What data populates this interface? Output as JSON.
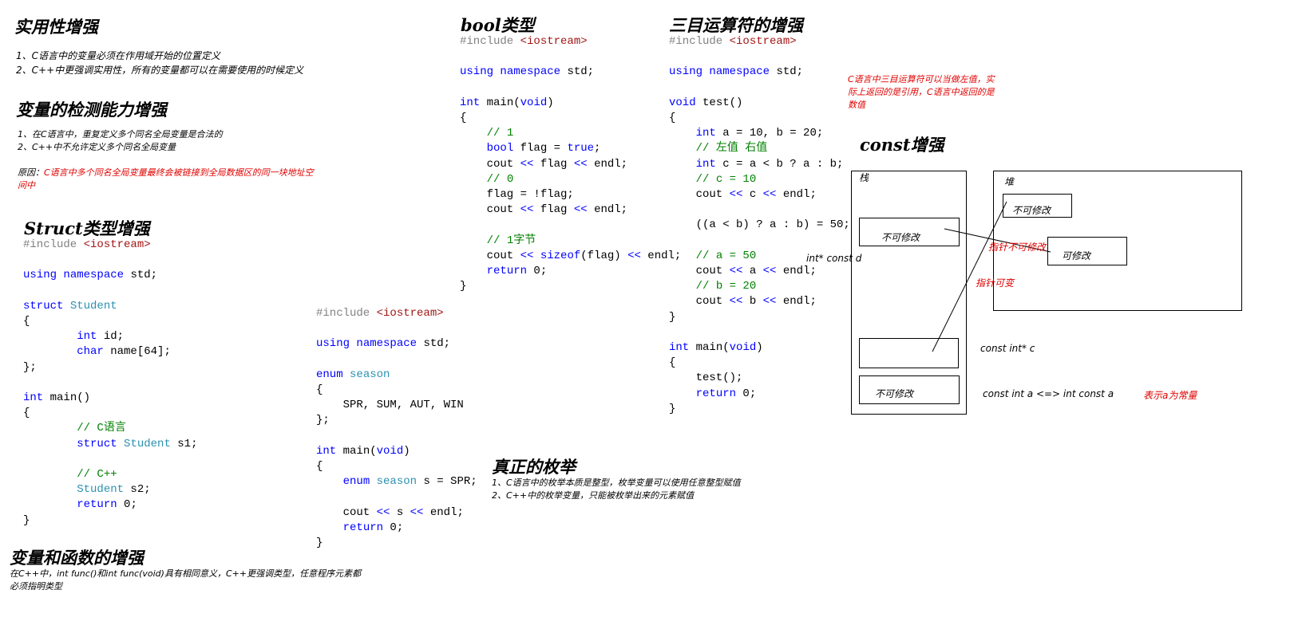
{
  "practicality": {
    "title": "实用性增强",
    "lines": [
      "1、C语言中的变量必须在作用域开始的位置定义",
      "2、C++中更强调实用性，所有的变量都可以在需要使用的时候定义"
    ]
  },
  "detection": {
    "title": "变量的检测能力增强",
    "lines": [
      "1、在C语言中，重复定义多个同名全局变量是合法的",
      "2、C++中不允许定义多个同名全局变量"
    ],
    "reason_prefix": "原因：",
    "reason_line1": "C语言中多个同名全局变量最终会被链接到全局数据区的同一块地址空",
    "reason_line2": "间中"
  },
  "struct_section": {
    "title": "Struct类型增强",
    "code": [
      [
        [
          "pp",
          "#include "
        ],
        [
          "inc",
          "<iostream>"
        ]
      ],
      [],
      [
        [
          "kw",
          "using"
        ],
        [
          "pl",
          " "
        ],
        [
          "kw",
          "namespace"
        ],
        [
          "pl",
          " std;"
        ]
      ],
      [],
      [
        [
          "kw",
          "struct"
        ],
        [
          "pl",
          " "
        ],
        [
          "ty",
          "Student"
        ]
      ],
      [
        [
          "pl",
          "{"
        ]
      ],
      [
        [
          "pl",
          "        "
        ],
        [
          "kw",
          "int"
        ],
        [
          "pl",
          " id;"
        ]
      ],
      [
        [
          "pl",
          "        "
        ],
        [
          "kw",
          "char"
        ],
        [
          "pl",
          " name[64];"
        ]
      ],
      [
        [
          "pl",
          "};"
        ]
      ],
      [],
      [
        [
          "kw",
          "int"
        ],
        [
          "pl",
          " main()"
        ]
      ],
      [
        [
          "pl",
          "{"
        ]
      ],
      [
        [
          "pl",
          "        "
        ],
        [
          "cm",
          "// C语言"
        ]
      ],
      [
        [
          "pl",
          "        "
        ],
        [
          "kw",
          "struct"
        ],
        [
          "pl",
          " "
        ],
        [
          "ty",
          "Student"
        ],
        [
          "pl",
          " s1;"
        ]
      ],
      [],
      [
        [
          "pl",
          "        "
        ],
        [
          "cm",
          "// C++"
        ]
      ],
      [
        [
          "pl",
          "        "
        ],
        [
          "ty",
          "Student"
        ],
        [
          "pl",
          " s2;"
        ]
      ],
      [
        [
          "pl",
          "        "
        ],
        [
          "kw",
          "return"
        ],
        [
          "pl",
          " 0;"
        ]
      ],
      [
        [
          "pl",
          "}"
        ]
      ]
    ]
  },
  "enum_code": [
    [
      [
        "pp",
        "#include "
      ],
      [
        "inc",
        "<iostream>"
      ]
    ],
    [],
    [
      [
        "kw",
        "using"
      ],
      [
        "pl",
        " "
      ],
      [
        "kw",
        "namespace"
      ],
      [
        "pl",
        " std;"
      ]
    ],
    [],
    [
      [
        "kw",
        "enum"
      ],
      [
        "pl",
        " "
      ],
      [
        "ty",
        "season"
      ]
    ],
    [
      [
        "pl",
        "{"
      ]
    ],
    [
      [
        "pl",
        "    SPR, SUM, AUT, WIN"
      ]
    ],
    [
      [
        "pl",
        "};"
      ]
    ],
    [],
    [
      [
        "kw",
        "int"
      ],
      [
        "pl",
        " main("
      ],
      [
        "kw",
        "void"
      ],
      [
        "pl",
        ")"
      ]
    ],
    [
      [
        "pl",
        "{"
      ]
    ],
    [
      [
        "pl",
        "    "
      ],
      [
        "kw",
        "enum"
      ],
      [
        "pl",
        " "
      ],
      [
        "ty",
        "season"
      ],
      [
        "pl",
        " s = SPR;"
      ]
    ],
    [],
    [
      [
        "pl",
        "    cout "
      ],
      [
        "op",
        "<<"
      ],
      [
        "pl",
        " s "
      ],
      [
        "op",
        "<<"
      ],
      [
        "pl",
        " endl;"
      ]
    ],
    [
      [
        "pl",
        "    "
      ],
      [
        "kw",
        "return"
      ],
      [
        "pl",
        " 0;"
      ]
    ],
    [
      [
        "pl",
        "}"
      ]
    ]
  ],
  "var_func": {
    "title": "变量和函数的增强",
    "line1": "在C++中，int func()和int func(void)具有相同意义，C++更强调类型，任意程序元素都",
    "line2": "必须指明类型"
  },
  "bool_section": {
    "title": "bool类型",
    "code": [
      [
        [
          "pp",
          "#include "
        ],
        [
          "inc",
          "<iostream>"
        ]
      ],
      [],
      [
        [
          "kw",
          "using"
        ],
        [
          "pl",
          " "
        ],
        [
          "kw",
          "namespace"
        ],
        [
          "pl",
          " std;"
        ]
      ],
      [],
      [
        [
          "kw",
          "int"
        ],
        [
          "pl",
          " main("
        ],
        [
          "kw",
          "void"
        ],
        [
          "pl",
          ")"
        ]
      ],
      [
        [
          "pl",
          "{"
        ]
      ],
      [
        [
          "pl",
          "    "
        ],
        [
          "cm",
          "// 1"
        ]
      ],
      [
        [
          "pl",
          "    "
        ],
        [
          "kw",
          "bool"
        ],
        [
          "pl",
          " flag = "
        ],
        [
          "kw",
          "true"
        ],
        [
          "pl",
          ";"
        ]
      ],
      [
        [
          "pl",
          "    cout "
        ],
        [
          "op",
          "<<"
        ],
        [
          "pl",
          " flag "
        ],
        [
          "op",
          "<<"
        ],
        [
          "pl",
          " endl;"
        ]
      ],
      [
        [
          "pl",
          "    "
        ],
        [
          "cm",
          "// 0"
        ]
      ],
      [
        [
          "pl",
          "    flag = !flag;"
        ]
      ],
      [
        [
          "pl",
          "    cout "
        ],
        [
          "op",
          "<<"
        ],
        [
          "pl",
          " flag "
        ],
        [
          "op",
          "<<"
        ],
        [
          "pl",
          " endl;"
        ]
      ],
      [],
      [
        [
          "pl",
          "    "
        ],
        [
          "cm",
          "// 1字节"
        ]
      ],
      [
        [
          "pl",
          "    cout "
        ],
        [
          "op",
          "<<"
        ],
        [
          "pl",
          " "
        ],
        [
          "kw",
          "sizeof"
        ],
        [
          "pl",
          "(flag) "
        ],
        [
          "op",
          "<<"
        ],
        [
          "pl",
          " endl;"
        ]
      ],
      [
        [
          "pl",
          "    "
        ],
        [
          "kw",
          "return"
        ],
        [
          "pl",
          " 0;"
        ]
      ],
      [
        [
          "pl",
          "}"
        ]
      ]
    ]
  },
  "enum_real": {
    "title": "真正的枚举",
    "lines": [
      "1、C语言中的枚举本质是整型，枚举变量可以使用任意整型赋值",
      "2、C++中的枚举变量，只能被枚举出来的元素赋值"
    ]
  },
  "ternary_section": {
    "title": "三目运算符的增强",
    "code": [
      [
        [
          "pp",
          "#include "
        ],
        [
          "inc",
          "<iostream>"
        ]
      ],
      [],
      [
        [
          "kw",
          "using"
        ],
        [
          "pl",
          " "
        ],
        [
          "kw",
          "namespace"
        ],
        [
          "pl",
          " std;"
        ]
      ],
      [],
      [
        [
          "kw",
          "void"
        ],
        [
          "pl",
          " test()"
        ]
      ],
      [
        [
          "pl",
          "{"
        ]
      ],
      [
        [
          "pl",
          "    "
        ],
        [
          "kw",
          "int"
        ],
        [
          "pl",
          " a = 10, b = 20;"
        ]
      ],
      [
        [
          "pl",
          "    "
        ],
        [
          "cm",
          "// 左值 右值"
        ]
      ],
      [
        [
          "pl",
          "    "
        ],
        [
          "kw",
          "int"
        ],
        [
          "pl",
          " c = a < b ? a : b;"
        ]
      ],
      [
        [
          "pl",
          "    "
        ],
        [
          "cm",
          "// c = 10"
        ]
      ],
      [
        [
          "pl",
          "    cout "
        ],
        [
          "op",
          "<<"
        ],
        [
          "pl",
          " c "
        ],
        [
          "op",
          "<<"
        ],
        [
          "pl",
          " endl;"
        ]
      ],
      [],
      [
        [
          "pl",
          "    ((a < b) ? a : b) = 50;"
        ]
      ],
      [],
      [
        [
          "pl",
          "    "
        ],
        [
          "cm",
          "// a = 50"
        ]
      ],
      [
        [
          "pl",
          "    cout "
        ],
        [
          "op",
          "<<"
        ],
        [
          "pl",
          " a "
        ],
        [
          "op",
          "<<"
        ],
        [
          "pl",
          " endl;"
        ]
      ],
      [
        [
          "pl",
          "    "
        ],
        [
          "cm",
          "// b = 20"
        ]
      ],
      [
        [
          "pl",
          "    cout "
        ],
        [
          "op",
          "<<"
        ],
        [
          "pl",
          " b "
        ],
        [
          "op",
          "<<"
        ],
        [
          "pl",
          " endl;"
        ]
      ],
      [
        [
          "pl",
          "}"
        ]
      ],
      [],
      [
        [
          "kw",
          "int"
        ],
        [
          "pl",
          " main("
        ],
        [
          "kw",
          "void"
        ],
        [
          "pl",
          ")"
        ]
      ],
      [
        [
          "pl",
          "{"
        ]
      ],
      [
        [
          "pl",
          "    test();"
        ]
      ],
      [
        [
          "pl",
          "    "
        ],
        [
          "kw",
          "return"
        ],
        [
          "pl",
          " 0;"
        ]
      ],
      [
        [
          "pl",
          "}"
        ]
      ]
    ],
    "note": [
      "C语言中三目运算符可以当做左值，实",
      "际上返回的是引用，C语言中返回的是",
      "数值"
    ]
  },
  "const_section": {
    "title": "const增强",
    "stack_label": "栈",
    "heap_label": "堆",
    "stack_box1": "不可修改",
    "stack_box3": "不可修改",
    "heap_box1": "不可修改",
    "heap_box2": "可修改",
    "label_int_const_d": "int* const d",
    "label_const_int_c": "const int* c",
    "label_const_int_a": "const int a <=> int const a",
    "label_const_meaning": "表示a为常量",
    "label_ptr_immutable": "指针不可修改",
    "label_ptr_mutable": "指针可变"
  }
}
